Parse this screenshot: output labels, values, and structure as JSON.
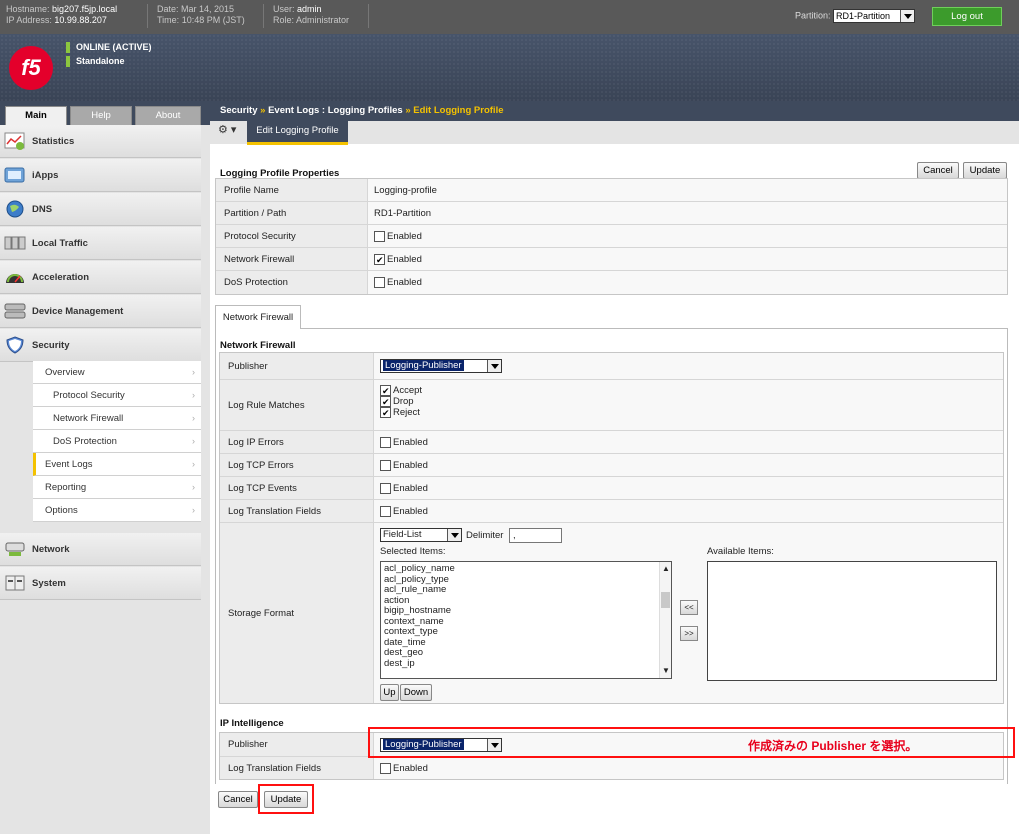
{
  "topbar": {
    "hostname_label": "Hostname:",
    "hostname": "big207.f5jp.local",
    "ip_label": "IP Address:",
    "ip": "10.99.88.207",
    "date_label": "Date:",
    "date": "Mar 14, 2015",
    "time_label": "Time:",
    "time": "10:48 PM (JST)",
    "user_label": "User:",
    "user": "admin",
    "role_label": "Role:",
    "role": "Administrator",
    "partition_label": "Partition:",
    "partition_value": "RD1-Partition",
    "logout_label": "Log out"
  },
  "banner": {
    "logo_text": "f5",
    "status_1": "ONLINE (ACTIVE)",
    "status_2": "Standalone",
    "status_color": "#8cc63f"
  },
  "tabs": [
    "Main",
    "Help",
    "About"
  ],
  "nav": {
    "statistics": "Statistics",
    "iapps": "iApps",
    "dns": "DNS",
    "local_traffic": "Local Traffic",
    "acceleration": "Acceleration",
    "device_management": "Device Management",
    "security": "Security",
    "network": "Network",
    "system": "System",
    "security_sub": [
      "Overview",
      "Protocol Security",
      "Network Firewall",
      "DoS Protection",
      "Event Logs",
      "Reporting",
      "Options"
    ]
  },
  "breadcrumb": {
    "part1": "Security",
    "sep1": "»",
    "part2": "Event Logs : Logging Profiles",
    "sep2": "»",
    "current": "Edit Logging Profile"
  },
  "menu": {
    "gear": "⚙ ▾",
    "edit_tab": "Edit Logging Profile"
  },
  "profile": {
    "title": "Logging Profile Properties",
    "cancel": "Cancel",
    "update": "Update",
    "rows": [
      {
        "label": "Profile Name",
        "value": "Logging-profile"
      },
      {
        "label": "Partition / Path",
        "value": "RD1-Partition"
      },
      {
        "label": "Protocol Security",
        "value": "Enabled",
        "checked": false
      },
      {
        "label": "Network Firewall",
        "value": "Enabled",
        "checked": true
      },
      {
        "label": "DoS Protection",
        "value": "Enabled",
        "checked": false
      }
    ]
  },
  "nf": {
    "tab": "Network Firewall",
    "title": "Network Firewall",
    "publisher_label": "Publisher",
    "publisher_value": "Logging-Publisher",
    "log_rule_matches_label": "Log Rule Matches",
    "rule_matches": [
      "Accept",
      "Drop",
      "Reject"
    ],
    "log_ip_errors_label": "Log IP Errors",
    "log_tcp_errors_label": "Log TCP Errors",
    "log_tcp_events_label": "Log TCP Events",
    "log_translation_label": "Log Translation Fields",
    "enabled": "Enabled",
    "storage_label": "Storage Format",
    "storage_type": "Field-List",
    "delimiter_label": "Delimiter",
    "delimiter_value": ",",
    "selected_items_label": "Selected Items:",
    "available_items_label": "Available Items:",
    "selected_items": [
      "acl_policy_name",
      "acl_policy_type",
      "acl_rule_name",
      "action",
      "bigip_hostname",
      "context_name",
      "context_type",
      "date_time",
      "dest_geo",
      "dest_ip"
    ],
    "move_left": "<<",
    "move_right": ">>",
    "up": "Up",
    "down": "Down"
  },
  "ipi": {
    "title": "IP Intelligence",
    "publisher_label": "Publisher",
    "publisher_value": "Logging-Publisher",
    "log_translation_label": "Log Translation Fields",
    "enabled": "Enabled"
  },
  "annotation": {
    "note": "作成済みの Publisher を選択。",
    "color": "#ff1010"
  },
  "bottom": {
    "cancel": "Cancel",
    "update": "Update"
  }
}
